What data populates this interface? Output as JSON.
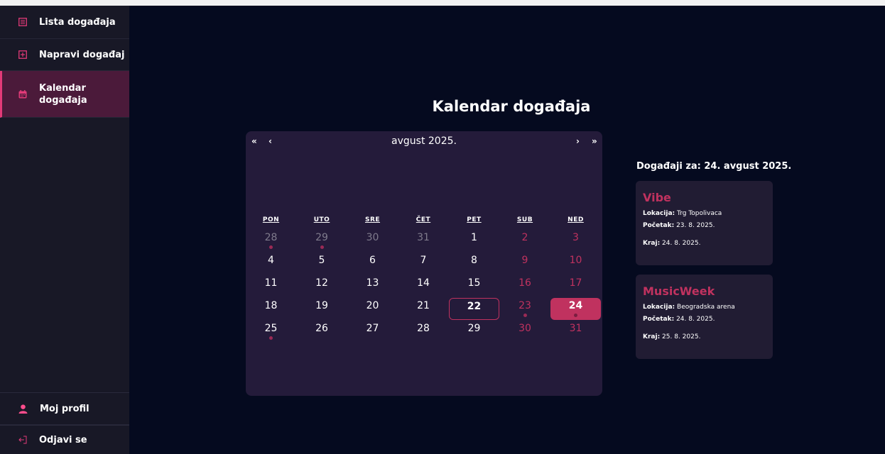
{
  "sidebar": {
    "items": [
      {
        "label": "Lista događaja",
        "icon": "list-icon"
      },
      {
        "label": "Napravi događaj",
        "icon": "add-square-icon"
      },
      {
        "label": "Kalendar događaja",
        "icon": "calendar-icon"
      }
    ],
    "bottom": [
      {
        "label": "Moj profil",
        "icon": "user-icon"
      },
      {
        "label": "Odjavi se",
        "icon": "logout-icon"
      }
    ]
  },
  "page": {
    "title": "Kalendar događaja"
  },
  "calendar": {
    "month_label": "avgust 2025.",
    "nav": {
      "prev_year": "«",
      "prev": "‹",
      "next": "›",
      "next_year": "»"
    },
    "weekdays": [
      "PON",
      "UTO",
      "SRE",
      "ČET",
      "PET",
      "SUB",
      "NED"
    ],
    "weeks": [
      [
        "28",
        "29",
        "30",
        "31",
        "1",
        "2",
        "3"
      ],
      [
        "4",
        "5",
        "6",
        "7",
        "8",
        "9",
        "10"
      ],
      [
        "11",
        "12",
        "13",
        "14",
        "15",
        "16",
        "17"
      ],
      [
        "18",
        "19",
        "20",
        "21",
        "22",
        "23",
        "24"
      ],
      [
        "25",
        "26",
        "27",
        "28",
        "29",
        "30",
        "31"
      ]
    ]
  },
  "events": {
    "heading": "Događaji za: 24. avgust 2025.",
    "labels": {
      "location": "Lokacija:",
      "start": "Početak:",
      "end": "Kraj:"
    },
    "items": [
      {
        "name": "Vibe",
        "location": "Trg Topolivaca",
        "start": "23. 8. 2025.",
        "end": "24. 8. 2025."
      },
      {
        "name": "MusicWeek",
        "location": "Beogradska arena",
        "start": "24. 8. 2025.",
        "end": "25. 8. 2025."
      }
    ]
  },
  "colors": {
    "background": "#050a1f",
    "sidebar": "#181826",
    "accent": "#c0325f",
    "calendar": "#241b3a"
  }
}
